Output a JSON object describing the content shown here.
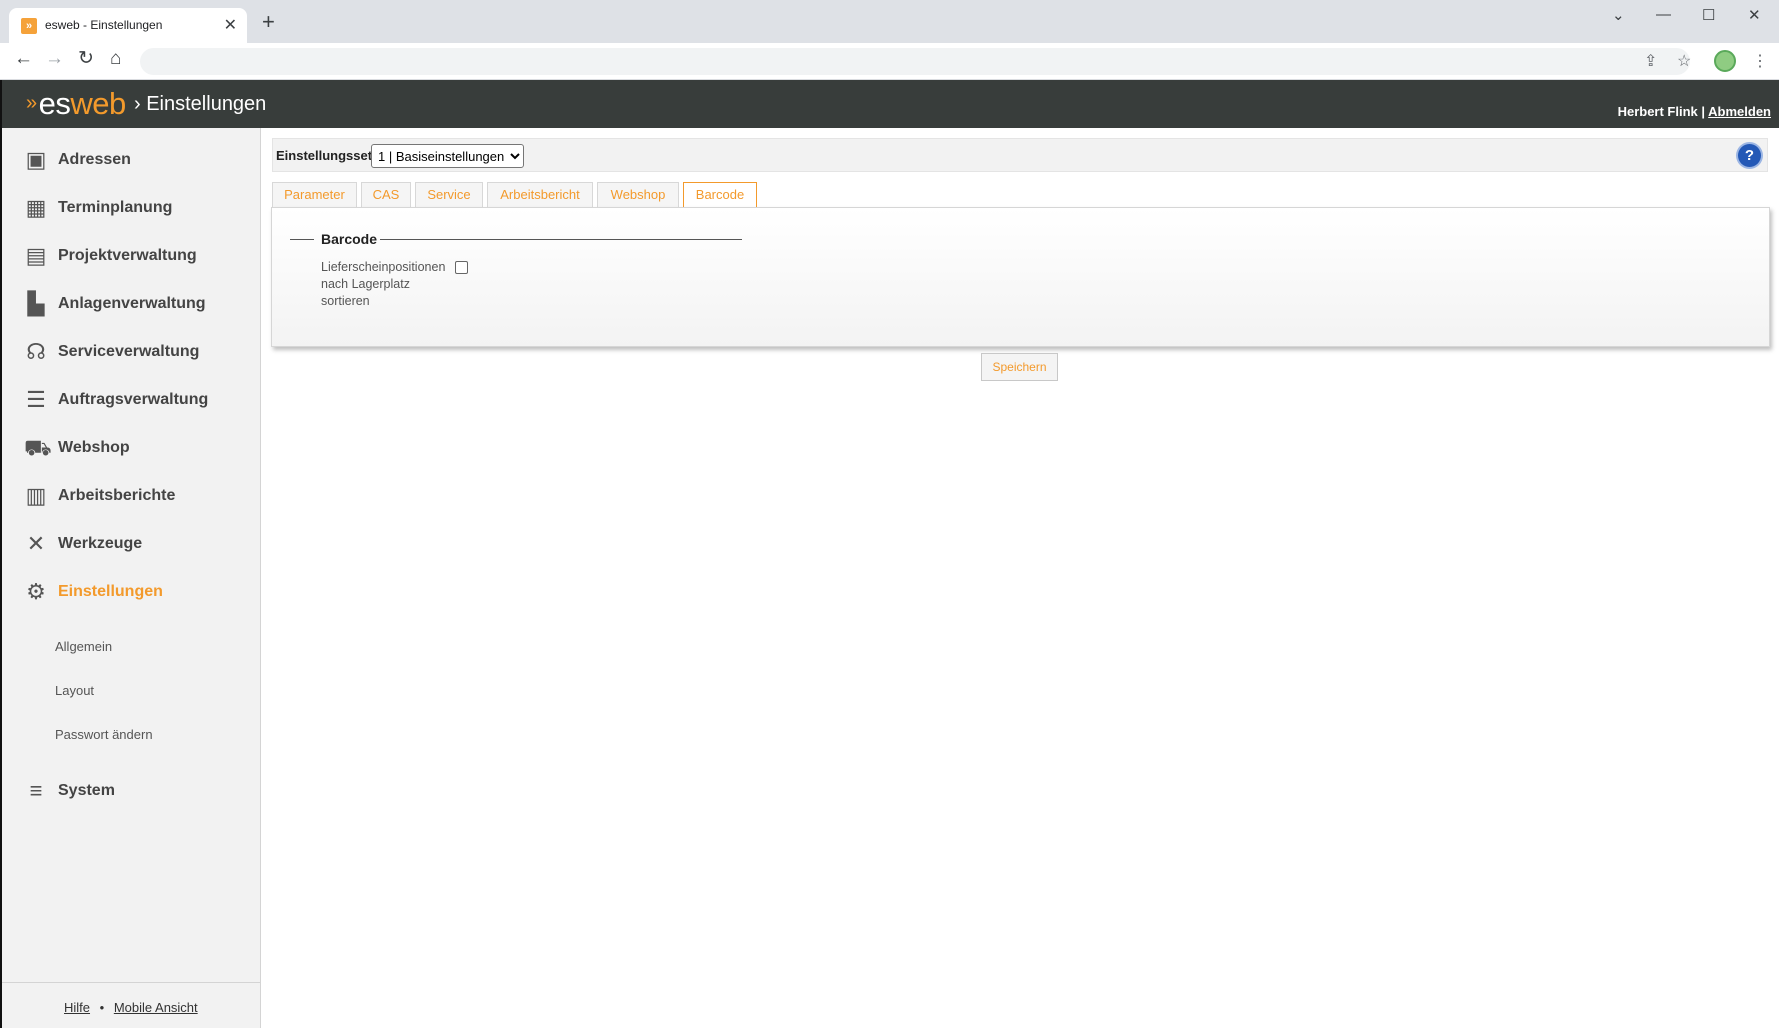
{
  "browser": {
    "tab_title": "esweb - Einstellungen",
    "tab_close": "✕",
    "new_tab": "+",
    "favicon_glyph": "»",
    "controls": {
      "minimize": "—",
      "maximize": "☐",
      "close": "✕",
      "dropdown": "⌄"
    },
    "nav": {
      "back": "←",
      "forward": "→",
      "reload": "↻",
      "home": "⌂"
    },
    "toolbar_icons": {
      "share": "⇪",
      "bookmark": "☆",
      "menu": "⋮"
    }
  },
  "header": {
    "logo_arrow": "»",
    "logo_es": "es",
    "logo_web": "web",
    "breadcrumb": "› Einstellungen",
    "user_name": "Herbert Flink",
    "separator": " | ",
    "logout": "Abmelden"
  },
  "sidebar": {
    "items": [
      {
        "label": "Adressen",
        "icon": "address-book-icon",
        "glyph": "▣"
      },
      {
        "label": "Terminplanung",
        "icon": "calendar-icon",
        "glyph": "▦"
      },
      {
        "label": "Projektverwaltung",
        "icon": "project-icon",
        "glyph": "▤"
      },
      {
        "label": "Anlagenverwaltung",
        "icon": "factory-icon",
        "glyph": "▙"
      },
      {
        "label": "Serviceverwaltung",
        "icon": "headset-icon",
        "glyph": "☊"
      },
      {
        "label": "Auftragsverwaltung",
        "icon": "list-icon",
        "glyph": "☰"
      },
      {
        "label": "Webshop",
        "icon": "cart-icon",
        "glyph": "⛟"
      },
      {
        "label": "Arbeitsberichte",
        "icon": "clipboard-icon",
        "glyph": "▥"
      },
      {
        "label": "Werkzeuge",
        "icon": "tools-icon",
        "glyph": "✕"
      },
      {
        "label": "Einstellungen",
        "icon": "gears-icon",
        "glyph": "⚙"
      },
      {
        "label": "System",
        "icon": "database-icon",
        "glyph": "≡"
      }
    ],
    "sub_items": [
      "Allgemein",
      "Layout",
      "Passwort ändern"
    ],
    "footer": {
      "help": "Hilfe",
      "dot": "•",
      "mobile": "Mobile Ansicht"
    }
  },
  "settings": {
    "set_label": "Einstellungsset",
    "set_value": "1 | Basiseinstellungen",
    "help_glyph": "?",
    "tabs": [
      "Parameter",
      "CAS",
      "Service",
      "Arbeitsbericht",
      "Webshop",
      "Barcode"
    ],
    "active_tab": "Barcode",
    "fieldset_title": "Barcode",
    "field_label": "Lieferscheinpositionen nach Lagerplatz sortieren",
    "field_checked": false,
    "save_label": "Speichern"
  },
  "colors": {
    "accent": "#f39a2c",
    "header_bg": "#383d3b",
    "sidebar_bg": "#f2f2f2"
  }
}
